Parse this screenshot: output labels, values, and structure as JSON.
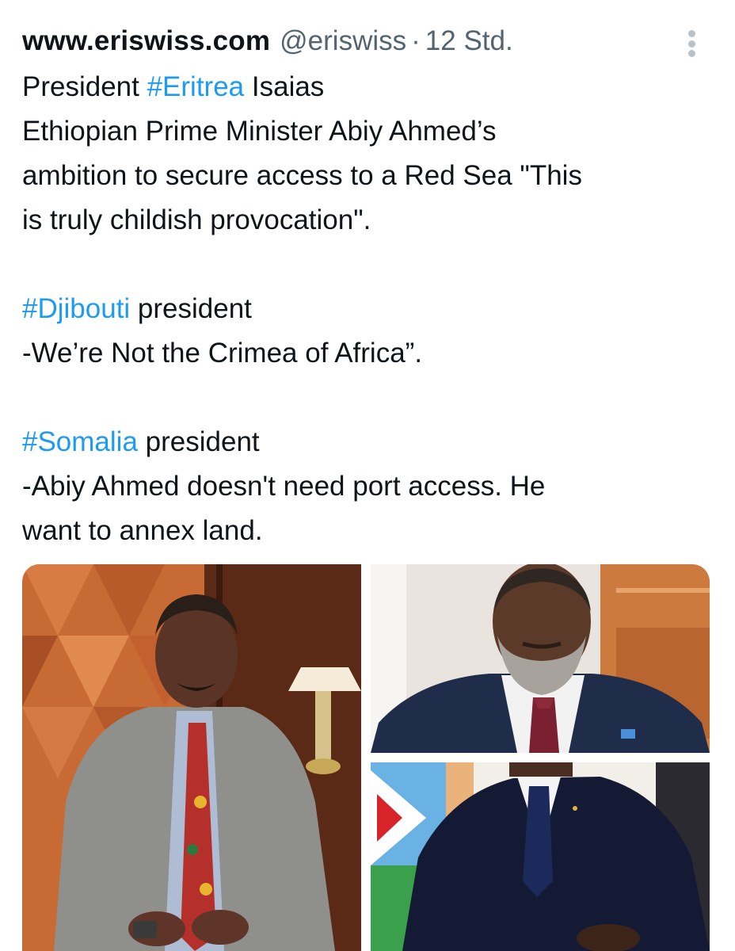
{
  "tweet": {
    "author_name": "www.eriswiss.com",
    "handle": "@eriswiss",
    "separator": "·",
    "timestamp": "12 Std.",
    "more_icon": "more-vertical-icon",
    "para1": {
      "line1_prefix": "President ",
      "line1_hashtag": "#Eritrea",
      "line1_suffix": " Isaias",
      "line2": "Ethiopian Prime Minister Abiy Ahmed’s",
      "line3": "ambition to secure access to a Red Sea \"This",
      "line4": "is truly childish provocation\"."
    },
    "para2": {
      "hashtag": "#Djibouti",
      "suffix": " president",
      "quote": "-We’re Not the Crimea of Africa”."
    },
    "para3": {
      "hashtag": "#Somalia",
      "suffix": " president",
      "quote_line1": "-Abiy Ahmed doesn't need port access. He",
      "quote_line2": "want to annex land."
    }
  },
  "colors": {
    "text": "#0f1419",
    "secondary": "#536471",
    "hashtag": "#1d9bf0",
    "background": "#ffffff"
  },
  "media": {
    "photos": [
      "Photo 1: man in grey suit and patterned tie, seated",
      "Photo 2: bearded man in navy suit with flag pin",
      "Photo 3: man in dark suit in front of flag"
    ]
  }
}
